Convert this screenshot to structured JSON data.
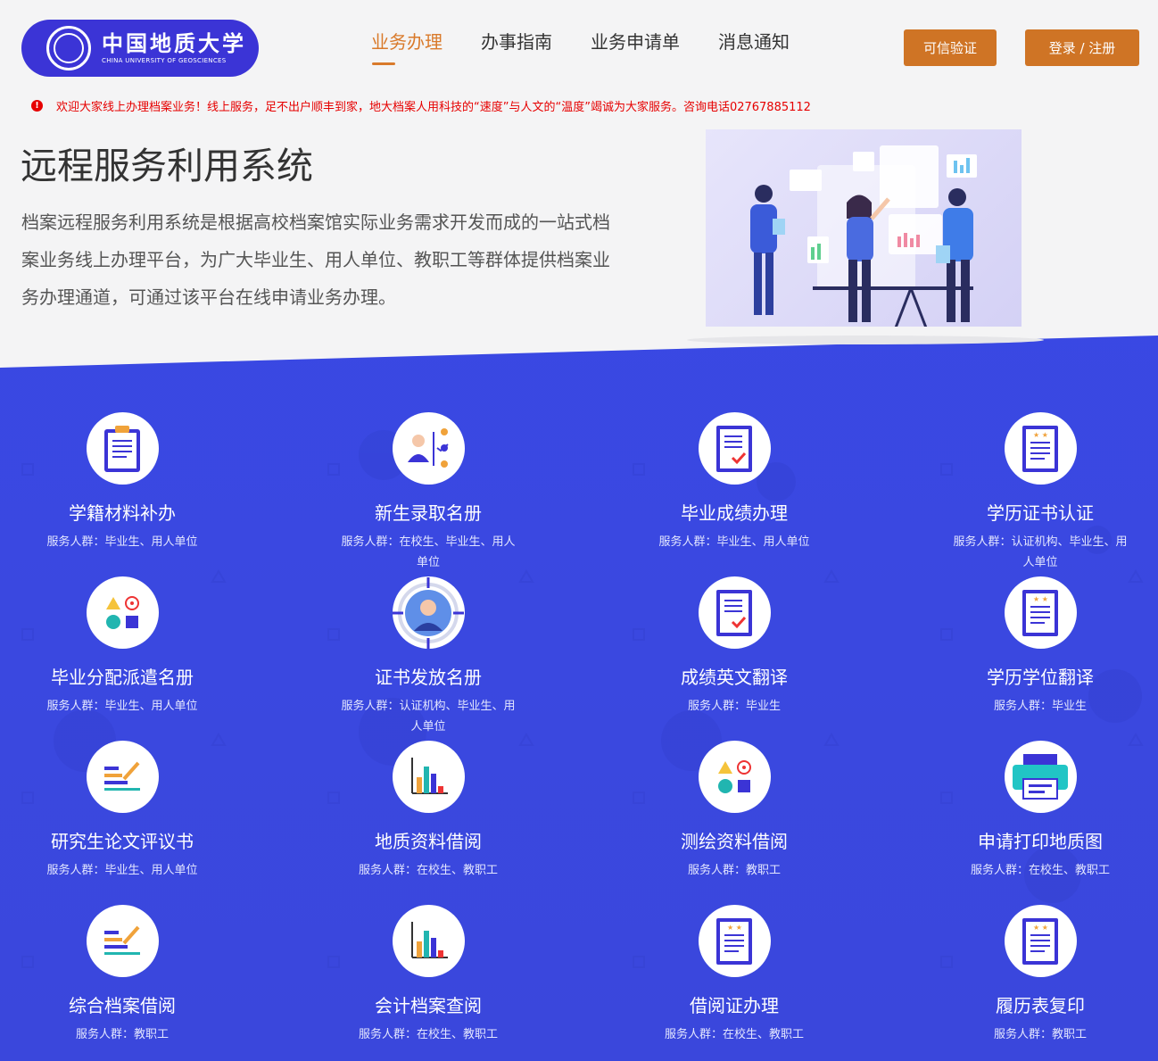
{
  "header": {
    "logo_cn": "中国地质大学",
    "logo_en": "CHINA UNIVERSITY OF GEOSCIENCES",
    "nav": [
      {
        "label": "业务办理",
        "active": true
      },
      {
        "label": "办事指南",
        "active": false
      },
      {
        "label": "业务申请单",
        "active": false
      },
      {
        "label": "消息通知",
        "active": false
      }
    ],
    "verify_label": "可信验证",
    "login_label": "登录 / 注册"
  },
  "notice": {
    "text": "欢迎大家线上办理档案业务！线上服务，足不出户顺丰到家，地大档案人用科技的“速度”与人文的“温度”竭诚为大家服务。咨询电话02767885112"
  },
  "intro": {
    "title": "远程服务利用系统",
    "description": "档案远程服务利用系统是根据高校档案馆实际业务需求开发而成的一站式档案业务线上办理平台，为广大毕业生、用人单位、教职工等群体提供档案业务办理通道，可通过该平台在线申请业务办理。"
  },
  "services": [
    {
      "title": "学籍材料补办",
      "audience": "服务人群：毕业生、用人单位",
      "icon": "clipboard-icon"
    },
    {
      "title": "新生录取名册",
      "audience": "服务人群：在校生、毕业生、用人单位",
      "icon": "roster-icon"
    },
    {
      "title": "毕业成绩办理",
      "audience": "服务人群：毕业生、用人单位",
      "icon": "checklist-icon"
    },
    {
      "title": "学历证书认证",
      "audience": "服务人群：认证机构、毕业生、用人单位",
      "icon": "certificate-icon"
    },
    {
      "title": "毕业分配派遣名册",
      "audience": "服务人群：毕业生、用人单位",
      "icon": "shapes-icon"
    },
    {
      "title": "证书发放名册",
      "audience": "服务人群：认证机构、毕业生、用人单位",
      "icon": "person-target-icon"
    },
    {
      "title": "成绩英文翻译",
      "audience": "服务人群：毕业生",
      "icon": "checklist-icon"
    },
    {
      "title": "学历学位翻译",
      "audience": "服务人群：毕业生",
      "icon": "certificate-icon"
    },
    {
      "title": "研究生论文评议书",
      "audience": "服务人群：毕业生、用人单位",
      "icon": "pen-lines-icon"
    },
    {
      "title": "地质资料借阅",
      "audience": "服务人群：在校生、教职工",
      "icon": "bar-chart-icon"
    },
    {
      "title": "测绘资料借阅",
      "audience": "服务人群：教职工",
      "icon": "shapes-icon"
    },
    {
      "title": "申请打印地质图",
      "audience": "服务人群：在校生、教职工",
      "icon": "printer-icon"
    },
    {
      "title": "综合档案借阅",
      "audience": "服务人群：教职工",
      "icon": "pen-lines-icon"
    },
    {
      "title": "会计档案查阅",
      "audience": "服务人群：在校生、教职工",
      "icon": "bar-chart-icon"
    },
    {
      "title": "借阅证办理",
      "audience": "服务人群：在校生、教职工",
      "icon": "certificate-icon"
    },
    {
      "title": "履历表复印",
      "audience": "服务人群：教职工",
      "icon": "certificate-icon"
    }
  ]
}
